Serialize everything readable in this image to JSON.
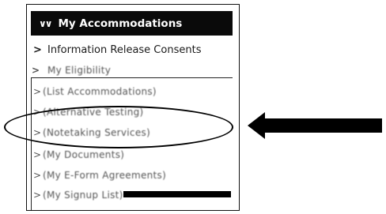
{
  "panel": {
    "title": "My Accommodations",
    "items": [
      {
        "label": "Information Release Consents"
      },
      {
        "label": "My Eligibility"
      },
      {
        "label": "(List Accommodations)"
      },
      {
        "label": "(Alternative Testing)"
      },
      {
        "label": "(Notetaking Services)"
      },
      {
        "label": "(My Documents)"
      },
      {
        "label": "(My E-Form Agreements)"
      },
      {
        "label": "(My Signup List)"
      }
    ],
    "highlighted_item": "(Notetaking Services)"
  },
  "colors": {
    "header_bg": "#0a0a0a",
    "header_text": "#ffffff",
    "annotation": "#000000"
  },
  "icons": {
    "header": "double-chevron-down-icon",
    "items": "chevron-right-icon",
    "annotation_arrow": "left-arrow-icon"
  }
}
